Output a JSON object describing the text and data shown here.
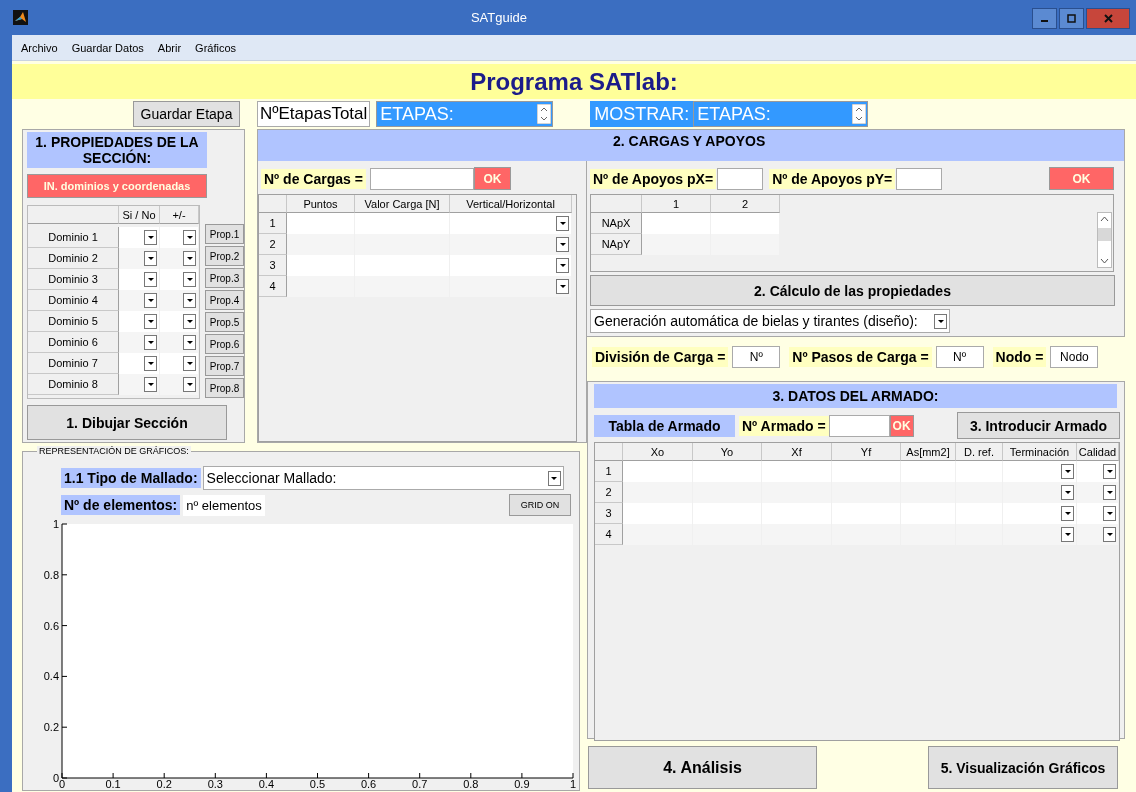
{
  "window": {
    "title": "SATguide"
  },
  "menu": [
    "Archivo",
    "Guardar Datos",
    "Abrir",
    "Gráficos"
  ],
  "heading": "Programa SATlab:",
  "toolbar": {
    "save_stage_button": "Guardar Etapa",
    "total_stages": "NºEtapasTotal",
    "stages_spinner": "ETAPAS:",
    "show_label": "MOSTRAR:",
    "show_spinner": "ETAPAS:"
  },
  "section1": {
    "title": "1. PROPIEDADES DE LA SECCIÓN:",
    "input_button": "IN. dominios y coordenadas",
    "columns": [
      {
        "label": "Si / No",
        "kind": "select"
      },
      {
        "label": "+/-",
        "kind": "select"
      }
    ],
    "rows": [
      {
        "label": "Dominio 1",
        "button": "Prop.1"
      },
      {
        "label": "Dominio 2",
        "button": "Prop.2"
      },
      {
        "label": "Dominio 3",
        "button": "Prop.3"
      },
      {
        "label": "Dominio 4",
        "button": "Prop.4"
      },
      {
        "label": "Dominio 5",
        "button": "Prop.5"
      },
      {
        "label": "Dominio 6",
        "button": "Prop.6"
      },
      {
        "label": "Dominio 7",
        "button": "Prop.7"
      },
      {
        "label": "Dominio 8",
        "button": "Prop.8"
      }
    ],
    "draw_button": "1. Dibujar Sección"
  },
  "section2": {
    "title": "2. CARGAS Y APOYOS",
    "loads_label": "Nº de Cargas =",
    "loads_ok": "OK",
    "loads_table": {
      "columns": [
        {
          "label": "Puntos",
          "kind": "text"
        },
        {
          "label": "Valor Carga [N]",
          "kind": "text"
        },
        {
          "label": "Vertical/Horizontal",
          "kind": "select"
        }
      ],
      "rows": [
        "1",
        "2",
        "3",
        "4"
      ]
    },
    "supports_x_label": "Nº de Apoyos pX=",
    "supports_y_label": "Nº de Apoyos pY=",
    "supports_ok": "OK",
    "supports_table": {
      "columns": [
        {
          "label": "1"
        },
        {
          "label": "2"
        }
      ],
      "rows": [
        "NApX",
        "NApY"
      ]
    },
    "calc_button": "2. Cálculo de las propiedades",
    "generation_select": "Generación automática de bielas y tirantes (diseño):"
  },
  "load_fields": [
    {
      "label": "División de Carga =",
      "value": "Nº"
    },
    {
      "label": "Nº Pasos de Carga =",
      "value": "Nº"
    },
    {
      "label": "Nodo =",
      "value": "Nodo"
    }
  ],
  "section3": {
    "title": "3. DATOS DEL ARMADO:",
    "table_label": "Tabla de Armado",
    "count_label": "Nº Armado =",
    "ok": "OK",
    "enter_button": "3. Introducir Armado",
    "columns": [
      {
        "label": "Xo",
        "kind": "text"
      },
      {
        "label": "Yo",
        "kind": "text"
      },
      {
        "label": "Xf",
        "kind": "text"
      },
      {
        "label": "Yf",
        "kind": "text"
      },
      {
        "label": "As[mm2]",
        "kind": "text"
      },
      {
        "label": "D. ref.",
        "kind": "text"
      },
      {
        "label": "Terminación",
        "kind": "select"
      },
      {
        "label": "Calidad",
        "kind": "select"
      }
    ],
    "rows": [
      "1",
      "2",
      "3",
      "4"
    ]
  },
  "plots": {
    "title": "REPRESENTACIÓN DE GRÁFICOS:",
    "mesh_label": "1.1 Tipo de Mallado:",
    "mesh_select": "Seleccionar Mallado:",
    "elements_label": "Nº de elementos:",
    "elements_value": "nº elementos",
    "grid_button": "GRID ON",
    "chart_data": {
      "type": "line",
      "xlim": [
        0,
        1
      ],
      "ylim": [
        0,
        1
      ],
      "xticks": [
        0,
        {
          "value": 0.1,
          "label": "0.1"
        },
        {
          "value": 0.2,
          "label": "0.2"
        },
        {
          "value": 0.3,
          "label": "0.3"
        },
        {
          "value": 0.4,
          "label": "0.4"
        },
        {
          "value": 0.5,
          "label": "0.5"
        },
        {
          "value": 0.6,
          "label": "0.6"
        },
        {
          "value": 0.7,
          "label": "0.7"
        },
        {
          "value": 0.8,
          "label": "0.8"
        },
        {
          "value": 0.9,
          "label": "0.9"
        },
        1
      ],
      "yticks": [
        0,
        {
          "value": 0.2,
          "label": "0.2"
        },
        {
          "value": 0.4,
          "label": "0.4"
        },
        {
          "value": 0.6,
          "label": "0.6"
        },
        {
          "value": 0.8,
          "label": "0.8"
        },
        1
      ]
    }
  },
  "actions": [
    "4. Análisis",
    "5. Visualización Gráficos"
  ]
}
